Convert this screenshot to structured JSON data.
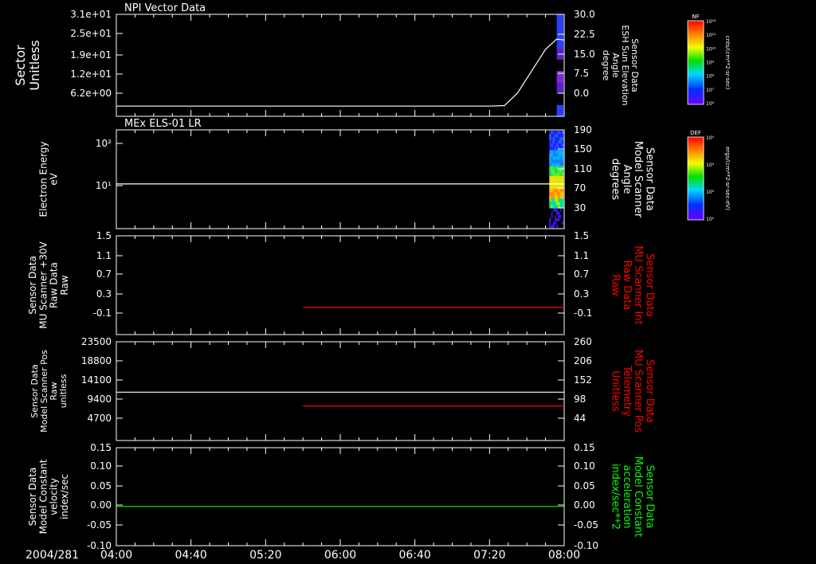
{
  "chart_data": {
    "type": "line",
    "time_axis": {
      "date_label": "2004/281",
      "ticks": [
        "04:00",
        "04:40",
        "05:20",
        "06:00",
        "06:40",
        "07:20",
        "08:00"
      ],
      "range": [
        "04:00",
        "08:00"
      ]
    },
    "panels": [
      {
        "id": "p1",
        "title": "NPI Vector Data",
        "left_label": [
          "Sector",
          "Unitless"
        ],
        "left_ticks": [
          "3.1e+01",
          "2.5e+01",
          "1.9e+01",
          "1.2e+01",
          "6.2e+00"
        ],
        "right_ticks": [
          "30.0",
          "22.5",
          "15.0",
          "7.5",
          "0.0"
        ],
        "right_label": [
          "Sensor Data",
          "ESH Sun Elevation",
          "Angle",
          "degree"
        ],
        "right_range": [
          -5,
          30
        ],
        "series": [
          {
            "color": "#ffffff",
            "axis": "right",
            "points": [
              [
                "04:00",
                -1.5
              ],
              [
                "07:20",
                -1.5
              ],
              [
                "07:28",
                -1.3
              ],
              [
                "07:35",
                3
              ],
              [
                "07:42",
                10
              ],
              [
                "07:50",
                18
              ],
              [
                "07:56",
                21.5
              ],
              [
                "08:00",
                21.2
              ]
            ]
          }
        ],
        "spectrogram": {
          "time_range": [
            "07:56",
            "08:00"
          ],
          "rows": [
            "#2b40f5",
            "#2b40f5",
            "#2b40f5",
            "#5a1fd0",
            "#000000",
            "#7c2bd8",
            "#5a1fd0",
            "#000000",
            "#2b40f5"
          ]
        }
      },
      {
        "id": "p2",
        "title": "MEx ELS-01 LR",
        "left_label": [
          "Electron Energy",
          "eV"
        ],
        "left_ticks": [
          "10²",
          "10¹"
        ],
        "right_ticks": [
          "190",
          "150",
          "110",
          "70",
          "30"
        ],
        "right_label": [
          "Sensor Data",
          "Model Scanner",
          "Angle",
          "degrees"
        ],
        "right_range": [
          0,
          190
        ],
        "series": [
          {
            "color": "#ffffff",
            "axis": "right",
            "points": [
              [
                "04:00",
                86
              ],
              [
                "08:00",
                86
              ]
            ]
          }
        ],
        "spectrogram": {
          "time_range": [
            "07:52",
            "08:00"
          ]
        }
      },
      {
        "id": "p3",
        "left_label": [
          "Sensor Data",
          "MU Scanner +30V",
          "Raw Data",
          "Raw"
        ],
        "left_ticks": [
          "1.5",
          "1.1",
          "0.7",
          "0.3",
          "-0.1"
        ],
        "right_ticks": [
          "1.5",
          "1.1",
          "0.7",
          "0.3",
          "-0.1"
        ],
        "right_label": [
          "Sensor Data",
          "MU Scanner Int",
          "Raw Data",
          "Raw"
        ],
        "right_label_color": "#ff0000",
        "right_range": [
          -0.5,
          1.5
        ],
        "series": [
          {
            "color": "#ff0000",
            "axis": "right",
            "points": [
              [
                "05:40",
                0.05
              ],
              [
                "08:00",
                0.05
              ]
            ]
          }
        ]
      },
      {
        "id": "p4",
        "left_label": [
          "Sensor Data",
          "Model Scanner Pos",
          "Raw",
          "unitless"
        ],
        "left_ticks": [
          "23500",
          "18800",
          "14100",
          "9400",
          "4700"
        ],
        "right_ticks": [
          "260",
          "206",
          "152",
          "98",
          "44"
        ],
        "right_label": [
          "Sensor Data",
          "MU Scanner Pos",
          "Telemetry",
          "Unitless"
        ],
        "right_label_color": "#ff0000",
        "left_range": [
          0,
          23500
        ],
        "right_range": [
          0,
          260
        ],
        "series": [
          {
            "color": "#ffffff",
            "axis": "left",
            "points": [
              [
                "04:00",
                11500
              ],
              [
                "08:00",
                11500
              ]
            ]
          },
          {
            "color": "#ff0000",
            "axis": "right",
            "points": [
              [
                "05:40",
                91
              ],
              [
                "08:00",
                91
              ]
            ]
          }
        ]
      },
      {
        "id": "p5",
        "left_label": [
          "Sensor Data",
          "Model Constant",
          "velocity",
          "index/sec"
        ],
        "left_ticks": [
          "0.15",
          "0.10",
          "0.05",
          "0.00",
          "-0.05",
          "-0.10"
        ],
        "right_ticks": [
          "0.15",
          "0.10",
          "0.05",
          "0.00",
          "-0.05",
          "-0.10"
        ],
        "right_label": [
          "Sensor Data",
          "Model Constant",
          "acceleration",
          "index/sec**2"
        ],
        "right_label_color": "#00ff00",
        "left_range": [
          -0.1,
          0.15
        ],
        "series": [
          {
            "color": "#00ff00",
            "axis": "left",
            "points": [
              [
                "04:00",
                0.0
              ],
              [
                "08:00",
                0.0
              ]
            ]
          }
        ]
      }
    ],
    "colorbars": [
      {
        "title": "NF",
        "ticks": [
          "10¹²",
          "10¹¹",
          "10¹⁰",
          "10⁹",
          "10⁸",
          "10⁷",
          "10⁶"
        ],
        "unit": "cnts/(cm**2-sr-sec)"
      },
      {
        "title": "DEF",
        "ticks": [
          "10⁴",
          "10³",
          "10²",
          "10¹"
        ],
        "unit": "ergs/(cm**2-sr-sec-eV)"
      }
    ]
  }
}
